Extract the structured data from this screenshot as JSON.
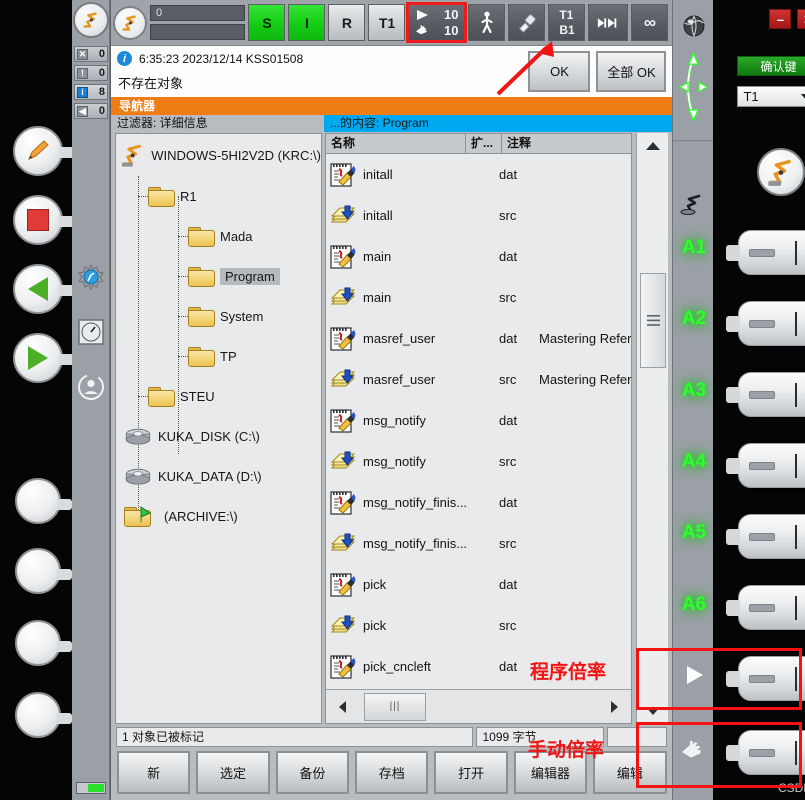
{
  "statusbar": {
    "program_field_value": "0",
    "sub_field_value": "",
    "s_label": "S",
    "i_label": "I",
    "r_label": "R",
    "mode_label": "T1",
    "program_override": "10",
    "manual_override": "10",
    "tool_label": "T1",
    "base_label": "B1",
    "infinity_label": "∞",
    "icons": {
      "robot": "robot-icon",
      "walking": "walking-man-icon",
      "tool": "tool-icon",
      "increment": "increment-icon",
      "program_override": "play-icon",
      "manual_override": "hand-icon"
    }
  },
  "message": {
    "timestamp": "6:35:23 2023/12/14 KSS01508",
    "text": "不存在对象",
    "ok_label": "OK",
    "ok_all_label": "全部 OK",
    "icon": "info-icon"
  },
  "counters": [
    {
      "icon": "error-icon",
      "value": "0"
    },
    {
      "icon": "warning-icon",
      "value": "0"
    },
    {
      "icon": "info-icon",
      "value": "8"
    },
    {
      "icon": "dialog-icon",
      "value": "0"
    }
  ],
  "navigator": {
    "title": "导航器",
    "filter_title": "过滤器: 详细信息",
    "content_title": "...的内容: Program"
  },
  "tree": {
    "root": "WINDOWS-5HI2V2D (KRC:\\)",
    "items": [
      {
        "label": "R1",
        "depth": 1,
        "type": "folder",
        "selected": false
      },
      {
        "label": "Mada",
        "depth": 2,
        "type": "folder",
        "selected": false
      },
      {
        "label": "Program",
        "depth": 2,
        "type": "folder",
        "selected": true
      },
      {
        "label": "System",
        "depth": 2,
        "type": "folder",
        "selected": false
      },
      {
        "label": "TP",
        "depth": 2,
        "type": "folder",
        "selected": false
      },
      {
        "label": "STEU",
        "depth": 1,
        "type": "folder",
        "selected": false
      },
      {
        "label": "KUKA_DISK (C:\\)",
        "depth": 0,
        "type": "drive",
        "selected": false
      },
      {
        "label": "KUKA_DATA (D:\\)",
        "depth": 0,
        "type": "drive",
        "selected": false
      },
      {
        "label": "(ARCHIVE:\\)",
        "depth": 0,
        "type": "archive",
        "selected": false
      }
    ]
  },
  "filelist": {
    "columns": {
      "name": "名称",
      "ext": "扩...",
      "comment": "注释"
    },
    "rows": [
      {
        "name": "initall",
        "ext": "dat",
        "comment": "",
        "icon": "dat-file-icon"
      },
      {
        "name": "initall",
        "ext": "src",
        "comment": "",
        "icon": "src-file-icon"
      },
      {
        "name": "main",
        "ext": "dat",
        "comment": "",
        "icon": "dat-file-icon"
      },
      {
        "name": "main",
        "ext": "src",
        "comment": "",
        "icon": "src-file-icon"
      },
      {
        "name": "masref_user",
        "ext": "dat",
        "comment": "Mastering Refer",
        "icon": "dat-file-icon"
      },
      {
        "name": "masref_user",
        "ext": "src",
        "comment": "Mastering Refer",
        "icon": "src-file-icon"
      },
      {
        "name": "msg_notify",
        "ext": "dat",
        "comment": "",
        "icon": "dat-file-icon"
      },
      {
        "name": "msg_notify",
        "ext": "src",
        "comment": "",
        "icon": "src-file-icon"
      },
      {
        "name": "msg_notify_finis...",
        "ext": "dat",
        "comment": "",
        "icon": "dat-file-icon"
      },
      {
        "name": "msg_notify_finis...",
        "ext": "src",
        "comment": "",
        "icon": "src-file-icon"
      },
      {
        "name": "pick",
        "ext": "dat",
        "comment": "",
        "icon": "dat-file-icon"
      },
      {
        "name": "pick",
        "ext": "src",
        "comment": "",
        "icon": "src-file-icon"
      },
      {
        "name": "pick_cncleft",
        "ext": "dat",
        "comment": "",
        "icon": "dat-file-icon"
      }
    ]
  },
  "bottom_status": {
    "selection": "1 对象已被标记",
    "size": "1099 字节",
    "extra": ""
  },
  "softkeys": [
    {
      "label": "新"
    },
    {
      "label": "选定"
    },
    {
      "label": "备份"
    },
    {
      "label": "存档"
    },
    {
      "label": "打开"
    },
    {
      "label": "编辑器"
    },
    {
      "label": "编辑"
    }
  ],
  "right_rail": {
    "icons": [
      {
        "name": "world-coord-icon"
      },
      {
        "name": "jog-arrows-icon"
      },
      {
        "name": "tool-coord-icon"
      },
      {
        "name": "program-override-icon"
      },
      {
        "name": "manual-override-icon"
      }
    ],
    "axis_labels": [
      "A1",
      "A2",
      "A3",
      "A4",
      "A5",
      "A6"
    ]
  },
  "right_panel": {
    "minimize_label": "–",
    "close_label": "✕",
    "confirm_label": "确认键",
    "mode_value": "T1",
    "robot_icon": "robot-icon"
  },
  "annotations": {
    "program_override": "程序倍率",
    "manual_override": "手动倍率",
    "watermark": "CSDN @欧阳&&"
  },
  "colors": {
    "orange": "#f07c16",
    "cyan": "#00a8f0",
    "green": "#14cc14",
    "annotation_red": "#f21414",
    "axis_green": "#2dff2d"
  }
}
